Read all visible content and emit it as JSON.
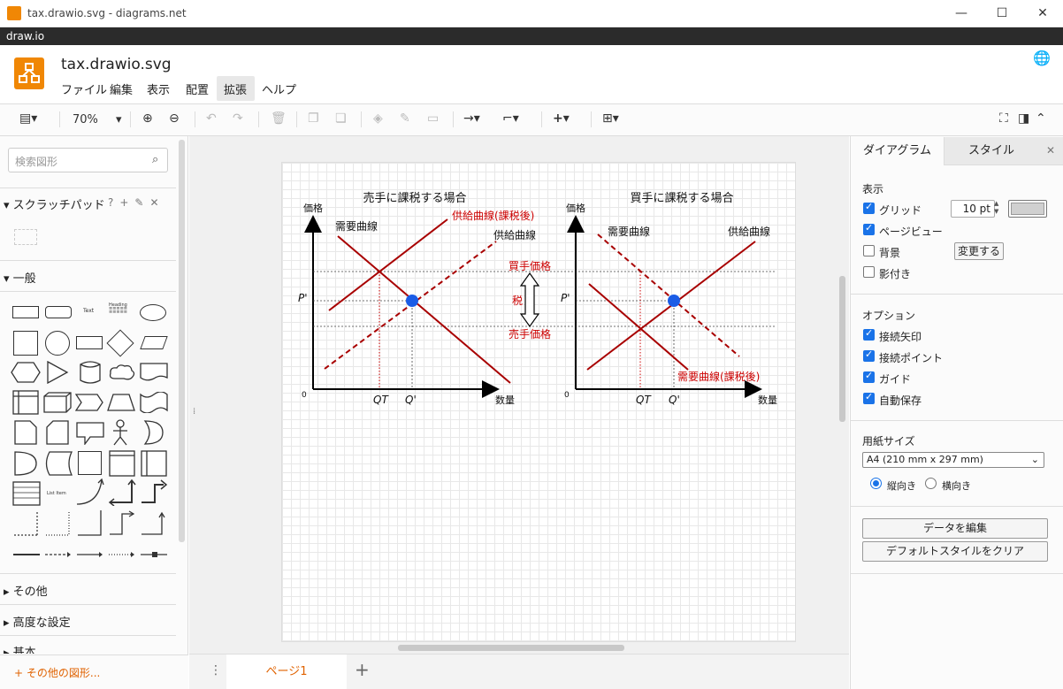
{
  "window": {
    "title": "tax.drawio.svg - diagrams.net",
    "minimize": "—",
    "maximize": "☐",
    "close": "✕"
  },
  "app_menu": "draw.io",
  "header": {
    "filename": "tax.drawio.svg",
    "menus": [
      "ファイル",
      "編集",
      "表示",
      "配置",
      "拡張",
      "ヘルプ"
    ]
  },
  "toolbar": {
    "zoom": "70%"
  },
  "sidebar": {
    "search_placeholder": "検索図形",
    "scratchpad": "スクラッチパッド",
    "general": "一般",
    "text_shape": "Text",
    "heading_shape": "Heading",
    "list_shape": "List Item",
    "other": "その他",
    "advanced": "高度な設定",
    "basic": "基本",
    "more_shapes": "その他の図形..."
  },
  "page_tab": "ページ1",
  "diagram": {
    "left": {
      "title": "売手に課税する場合",
      "ylabel": "価格",
      "xlabel": "数量",
      "origin": "0",
      "demand": "需要曲線",
      "supply": "供給曲線",
      "supply_taxed": "供給曲線(課税後)",
      "p_label": "P'",
      "qt_label": "QT",
      "q_label": "Q'"
    },
    "right": {
      "title": "買手に課税する場合",
      "ylabel": "価格",
      "xlabel": "数量",
      "origin": "0",
      "demand": "需要曲線",
      "supply": "供給曲線",
      "demand_taxed": "需要曲線(課税後)",
      "p_label": "P'",
      "qt_label": "QT",
      "q_label": "Q'"
    },
    "buyer_price": "買手価格",
    "seller_price": "売手価格",
    "tax": "税"
  },
  "right_panel": {
    "tab_diagram": "ダイアグラム",
    "tab_style": "スタイル",
    "view_section": "表示",
    "grid": "グリッド",
    "grid_size": "10 pt",
    "page_view": "ページビュー",
    "background": "背景",
    "change_button": "変更する",
    "shadow": "影付き",
    "options_section": "オプション",
    "connection_arrows": "接続矢印",
    "connection_points": "接続ポイント",
    "guides": "ガイド",
    "autosave": "自動保存",
    "paper_size_section": "用紙サイズ",
    "paper_size": "A4 (210 mm x 297 mm)",
    "portrait": "縦向き",
    "landscape": "横向き",
    "edit_data": "データを編集",
    "clear_default_style": "デフォルトスタイルをクリア"
  },
  "colors": {
    "accent": "#f08705",
    "curve": "#a80000",
    "red_text": "#cc0000",
    "point": "#1a5ce6"
  }
}
